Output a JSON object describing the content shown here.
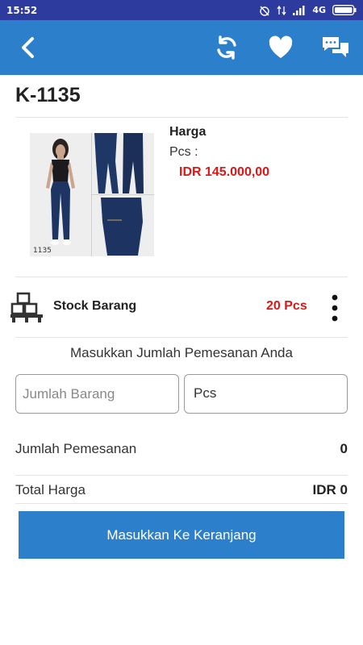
{
  "status_bar": {
    "time": "15:52",
    "network": "4G"
  },
  "app_bar": {
    "back_icon": "arrow-back-icon",
    "actions": [
      "refresh-icon",
      "heart-icon",
      "chat-icon"
    ]
  },
  "product": {
    "code": "K-1135",
    "image_label": "1135",
    "price_label": "Harga",
    "unit_label": "Pcs :",
    "price": "IDR 145.000,00"
  },
  "stock": {
    "label": "Stock Barang",
    "value": "20 Pcs"
  },
  "order": {
    "prompt": "Masukkan Jumlah Pemesanan Anda",
    "quantity_placeholder": "Jumlah Barang",
    "unit": "Pcs",
    "total_qty_label": "Jumlah Pemesanan",
    "total_qty_value": "0",
    "total_price_label": "Total Harga",
    "total_price_value": "IDR 0"
  },
  "cart_button_label": "Masukkan Ke Keranjang",
  "colors": {
    "primary": "#2b7fcb",
    "status_bar": "#2d3a9e",
    "price": "#e01616"
  }
}
